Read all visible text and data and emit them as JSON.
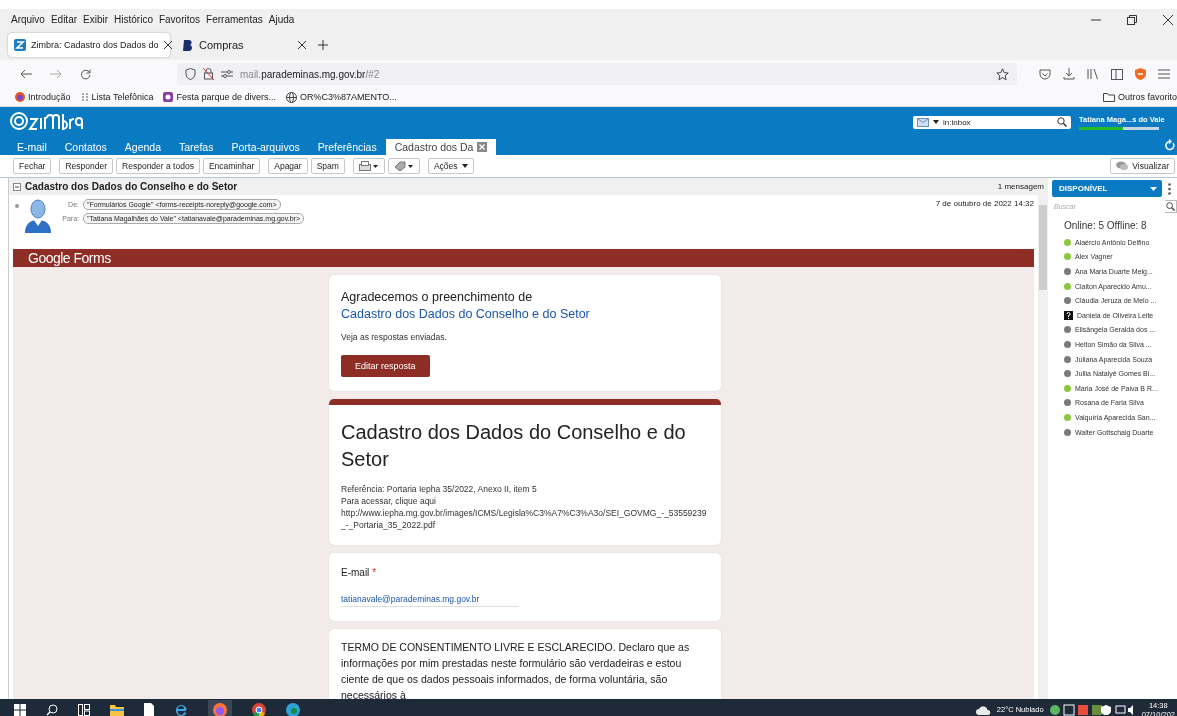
{
  "menu_bar": [
    "Arquivo",
    "Editar",
    "Exibir",
    "Histórico",
    "Favoritos",
    "Ferramentas",
    "Ajuda"
  ],
  "browser_tabs": [
    {
      "title": "Zimbra: Cadastro dos Dados do",
      "selected": true
    },
    {
      "title": "Compras",
      "selected": false
    }
  ],
  "address_bar": {
    "prefix": "mail.",
    "domain": "parademinas.mg.gov.br",
    "path": "/#2"
  },
  "bookmarks": [
    "Introdução",
    "Lista Telefônica",
    "Festa parque de divers...",
    "OR%C3%87AMENTO..."
  ],
  "other_bookmarks": "Outros favorito",
  "zimbra": {
    "search_value": "in:inbox",
    "user": "Tatiana Maga...s do Vale",
    "quota": {
      "level": 0.55
    }
  },
  "app_tabs": [
    {
      "label": "E-mail",
      "selected": false
    },
    {
      "label": "Contatos",
      "selected": false
    },
    {
      "label": "Agenda",
      "selected": false
    },
    {
      "label": "Tarefas",
      "selected": false
    },
    {
      "label": "Porta-arquivos",
      "selected": false
    },
    {
      "label": "Preferências",
      "selected": false
    },
    {
      "label": "Cadastro dos Da",
      "selected": true
    }
  ],
  "toolbar": [
    {
      "kind": "text",
      "label": "Fechar"
    },
    {
      "kind": "text",
      "label": "Responder"
    },
    {
      "kind": "text",
      "label": "Responder a todos"
    },
    {
      "kind": "text",
      "label": "Encaminhar"
    },
    {
      "kind": "text",
      "label": "Apagar"
    },
    {
      "kind": "text",
      "label": "Spam"
    },
    {
      "kind": "print"
    },
    {
      "kind": "tag"
    },
    {
      "kind": "menu",
      "label": "Ações"
    }
  ],
  "view_button": "Visualizar",
  "message": {
    "subject": "Cadastro dos Dados do Conselho e do Setor",
    "count": "1 mensagem",
    "date": "7 de outubro de 2022 14:32",
    "from_label": "De:",
    "from": "\"Formulários Google\" <forms-receipts-noreply@google.com>",
    "to_label": "Para:",
    "to": "\"Tatiana Magalhães do Vale\" <tatianavale@parademinas.mg.gov.br>"
  },
  "form_banner": {
    "brand": "Google Forms"
  },
  "cards": [
    {
      "kind": "confirmation",
      "lead": "Agradecemos o preenchimento de",
      "link": "Cadastro dos Dados do Conselho e do Setor",
      "note": "Veja as respostas enviadas.",
      "button": "Editar resposta"
    },
    {
      "kind": "header",
      "title": "Cadastro dos Dados do Conselho e do Setor",
      "reference": "Referência: Portaria Iepha 35/2022, Anexo II, item 5",
      "access_text": "Para acessar, clique aqui",
      "link": "http://www.iepha.mg.gov.br/images/ICMS/Legisla%C3%A7%C3%A3o/SEI_GOVMG_-_53559239_-_Portaria_35_2022.pdf"
    },
    {
      "kind": "answer",
      "question": "E-mail",
      "required_mark": "*",
      "answer": "tatianavale@parademinas.mg.gov.br"
    },
    {
      "kind": "text",
      "text": "TERMO DE CONSENTIMENTO LIVRE E ESCLARECIDO. Declaro que as informações por mim prestadas neste formulário são verdadeiras e estou ciente de que os dados pessoais informados, de forma voluntária, são necessários à"
    }
  ],
  "chat": {
    "status": "DISPONÍVEL",
    "search_placeholder": "Buscar",
    "summary": "Online: 5 Offline: 8",
    "contacts": [
      {
        "name": "Alaércio Antônio Delfino",
        "kind": "dot",
        "color": "#8cc63f"
      },
      {
        "name": "Alex Vagner",
        "kind": "dot",
        "color": "#8cc63f"
      },
      {
        "name": "Ana Maria Duarte Melg...",
        "kind": "dot",
        "color": "#7a7a7a"
      },
      {
        "name": "Claiton Aparecido Amu...",
        "kind": "dot",
        "color": "#8cc63f"
      },
      {
        "name": "Cláudia Jeruza de Melo ...",
        "kind": "dot",
        "color": "#7a7a7a"
      },
      {
        "name": "Daniela de Oliveira Leite",
        "kind": "unknown"
      },
      {
        "name": "Elisângela Geralda dos ...",
        "kind": "dot",
        "color": "#7a7a7a"
      },
      {
        "name": "Helton Simão da Silva ...",
        "kind": "dot",
        "color": "#7a7a7a"
      },
      {
        "name": "Juliana Aparecida Souza",
        "kind": "dot",
        "color": "#7a7a7a"
      },
      {
        "name": "Jullia Natalyê Gomes Bi...",
        "kind": "dot",
        "color": "#7a7a7a"
      },
      {
        "name": "Maria José de Paiva B R...",
        "kind": "dot",
        "color": "#8cc63f"
      },
      {
        "name": "Rosana de Faria Silva",
        "kind": "dot",
        "color": "#7a7a7a"
      },
      {
        "name": "Valquíria Aparecida San...",
        "kind": "dot",
        "color": "#8cc63f"
      },
      {
        "name": "Walter Gottschalg Duarte",
        "kind": "dot",
        "color": "#7a7a7a"
      }
    ]
  },
  "taskbar": {
    "weather": "22°C Nublado",
    "time": "14:38",
    "date": "07/10/202"
  }
}
